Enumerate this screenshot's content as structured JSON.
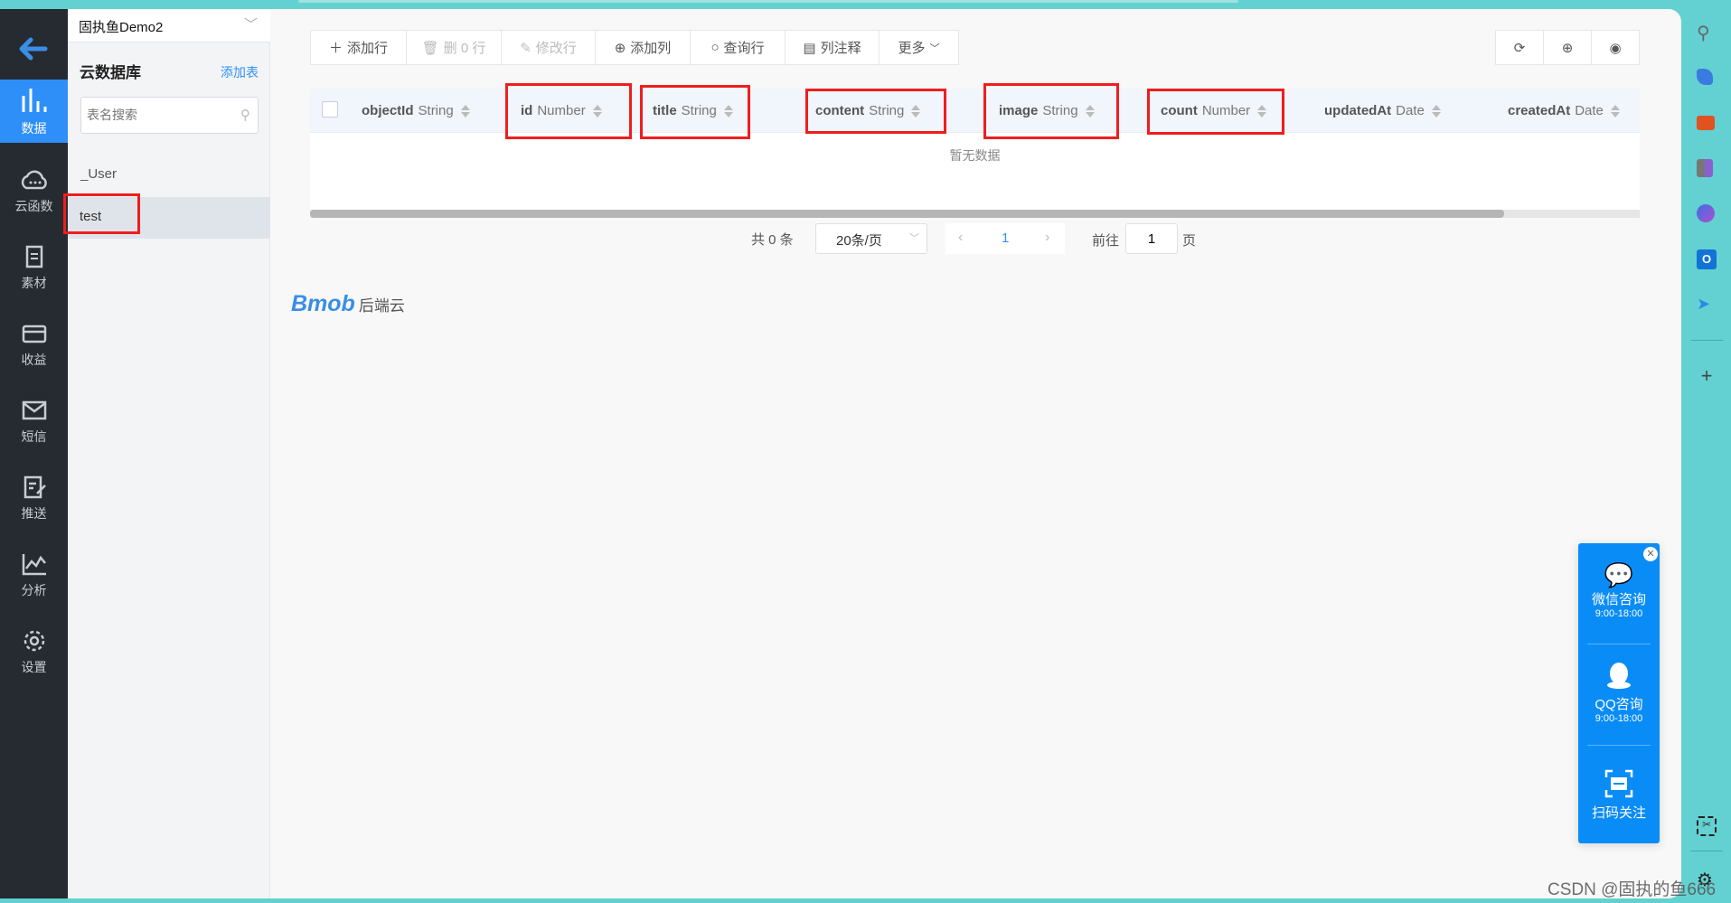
{
  "project": {
    "name": "固执鱼Demo2"
  },
  "nav": [
    {
      "label": "数据",
      "icon": "bar-chart-icon",
      "active": true
    },
    {
      "label": "云函数",
      "icon": "cloud-icon"
    },
    {
      "label": "素材",
      "icon": "files-icon"
    },
    {
      "label": "收益",
      "icon": "card-icon"
    },
    {
      "label": "短信",
      "icon": "mail-icon"
    },
    {
      "label": "推送",
      "icon": "push-icon"
    },
    {
      "label": "分析",
      "icon": "analytics-icon"
    },
    {
      "label": "设置",
      "icon": "gear-icon"
    }
  ],
  "panel": {
    "title": "云数据库",
    "add_table": "添加表",
    "search_placeholder": "表名搜索",
    "tables": [
      "_User",
      "test"
    ],
    "selected": "test"
  },
  "toolbar": {
    "add_row": "添加行",
    "delete_rows": "删 0 行",
    "edit_row": "修改行",
    "add_column": "添加列",
    "query_row": "查询行",
    "column_note": "列注释",
    "more": "更多"
  },
  "table": {
    "columns": [
      {
        "name": "objectId",
        "type": "String"
      },
      {
        "name": "id",
        "type": "Number"
      },
      {
        "name": "title",
        "type": "String"
      },
      {
        "name": "content",
        "type": "String"
      },
      {
        "name": "image",
        "type": "String"
      },
      {
        "name": "count",
        "type": "Number"
      },
      {
        "name": "updatedAt",
        "type": "Date"
      },
      {
        "name": "createdAt",
        "type": "Date"
      }
    ],
    "empty_text": "暂无数据"
  },
  "pagination": {
    "total": "共 0 条",
    "page_size": "20条/页",
    "current": "1",
    "goto_label": "前往",
    "goto_value": "1",
    "page_suffix": "页"
  },
  "brand": {
    "logo": "Bmob",
    "suffix": "后端云"
  },
  "float_panel": {
    "wechat": "微信咨询",
    "wechat_hours": "9:00-18:00",
    "qq": "QQ咨询",
    "qq_hours": "9:00-18:00",
    "scan": "扫码关注"
  },
  "watermark": "CSDN @固执的鱼666",
  "colors": {
    "accent": "#2f8ff8",
    "highlight": "#f01d1d",
    "frame": "#63d1d1",
    "float": "#0a8cf7"
  }
}
